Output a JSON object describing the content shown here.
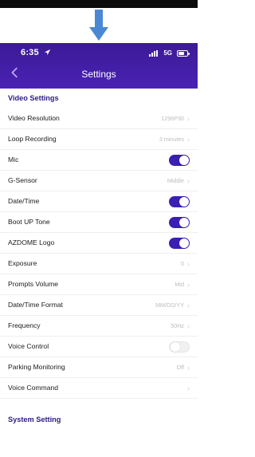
{
  "status": {
    "time": "6:35",
    "signal": "5G"
  },
  "nav": {
    "title": "Settings"
  },
  "sections": {
    "video_header": "Video Settings",
    "system_header": "System Setting"
  },
  "rows": [
    {
      "label": "Video Resolution",
      "value": "1296P30",
      "type": "value"
    },
    {
      "label": "Loop Recording",
      "value": "3 minutes",
      "type": "value"
    },
    {
      "label": "Mic",
      "type": "toggle",
      "on": true
    },
    {
      "label": "G-Sensor",
      "value": "Middle",
      "type": "value"
    },
    {
      "label": "Date/Time",
      "type": "toggle",
      "on": true
    },
    {
      "label": "Boot UP Tone",
      "type": "toggle",
      "on": true
    },
    {
      "label": "AZDOME Logo",
      "type": "toggle",
      "on": true
    },
    {
      "label": "Exposure",
      "value": "0",
      "type": "value"
    },
    {
      "label": "Prompts Volume",
      "value": "Mid",
      "type": "value"
    },
    {
      "label": "Date/Time Format",
      "value": "MM/DD/YY",
      "type": "value"
    },
    {
      "label": "Frequency",
      "value": "50Hz",
      "type": "value"
    },
    {
      "label": "Voice Control",
      "type": "toggle",
      "on": false
    },
    {
      "label": "Parking Monitoring",
      "value": "Off",
      "type": "value"
    },
    {
      "label": "Voice Command",
      "value": "",
      "type": "value"
    }
  ],
  "colors": {
    "accent": "#3a1fb2",
    "header_bg": "#4a22b4",
    "arrow": "#4a88d6"
  },
  "icons": {
    "arrow": "down-arrow-icon",
    "back": "chevron-left-icon",
    "location": "location-arrow-icon",
    "battery": "battery-icon"
  }
}
